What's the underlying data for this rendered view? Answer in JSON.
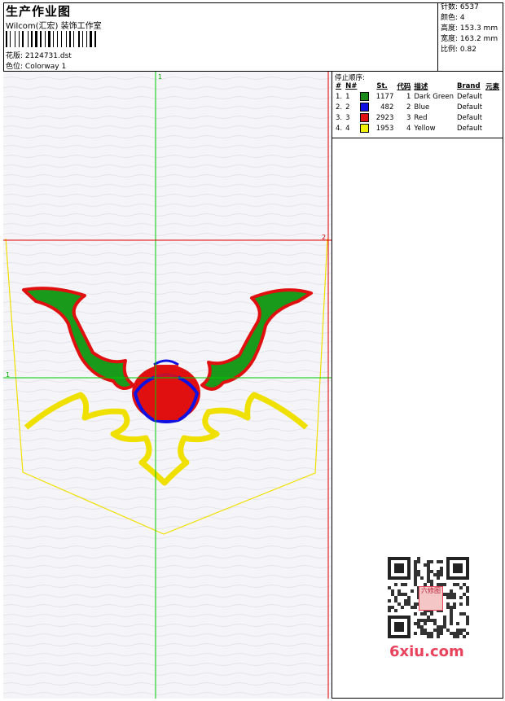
{
  "header": {
    "title": "生产作业图",
    "company": "Wilcom(汇宏) 装饰工作室",
    "file_label": "花版:",
    "file_value": "2124731.dst",
    "colorway_label": "色位:",
    "colorway_value": "Colorway 1"
  },
  "stats": [
    {
      "label": "针数:",
      "value": "6537"
    },
    {
      "label": "颜色:",
      "value": "4"
    },
    {
      "label": "高度:",
      "value": "153.3 mm"
    },
    {
      "label": "宽度:",
      "value": "163.2 mm"
    },
    {
      "label": "比例:",
      "value": "0.82"
    }
  ],
  "stop_sequence": {
    "title": "停止顺序:",
    "columns": [
      "#",
      "N#",
      "St.",
      "代码",
      "描述",
      "Brand",
      "元素"
    ],
    "rows": [
      {
        "idx": "1.",
        "n": "1",
        "color": "#1a8a1a",
        "st": "1177",
        "code": "1",
        "desc": "Dark Green",
        "brand": "Default",
        "elem": ""
      },
      {
        "idx": "2.",
        "n": "2",
        "color": "#1010e0",
        "st": "482",
        "code": "2",
        "desc": "Blue",
        "brand": "Default",
        "elem": ""
      },
      {
        "idx": "3.",
        "n": "3",
        "color": "#e01010",
        "st": "2923",
        "code": "3",
        "desc": "Red",
        "brand": "Default",
        "elem": ""
      },
      {
        "idx": "4.",
        "n": "4",
        "color": "#f0f000",
        "st": "1953",
        "code": "4",
        "desc": "Yellow",
        "brand": "Default",
        "elem": ""
      }
    ]
  },
  "guides": {
    "v_green_label": "1",
    "h_green_label": "1",
    "h_red_label": "2"
  },
  "watermark": {
    "qr_badge": "六修图",
    "text": "6xiu.com"
  },
  "colors": {
    "green_guide": "#00cc00",
    "red_guide": "#e00000",
    "yellow_outline": "#f0e000",
    "watermark": "#e8425c"
  }
}
